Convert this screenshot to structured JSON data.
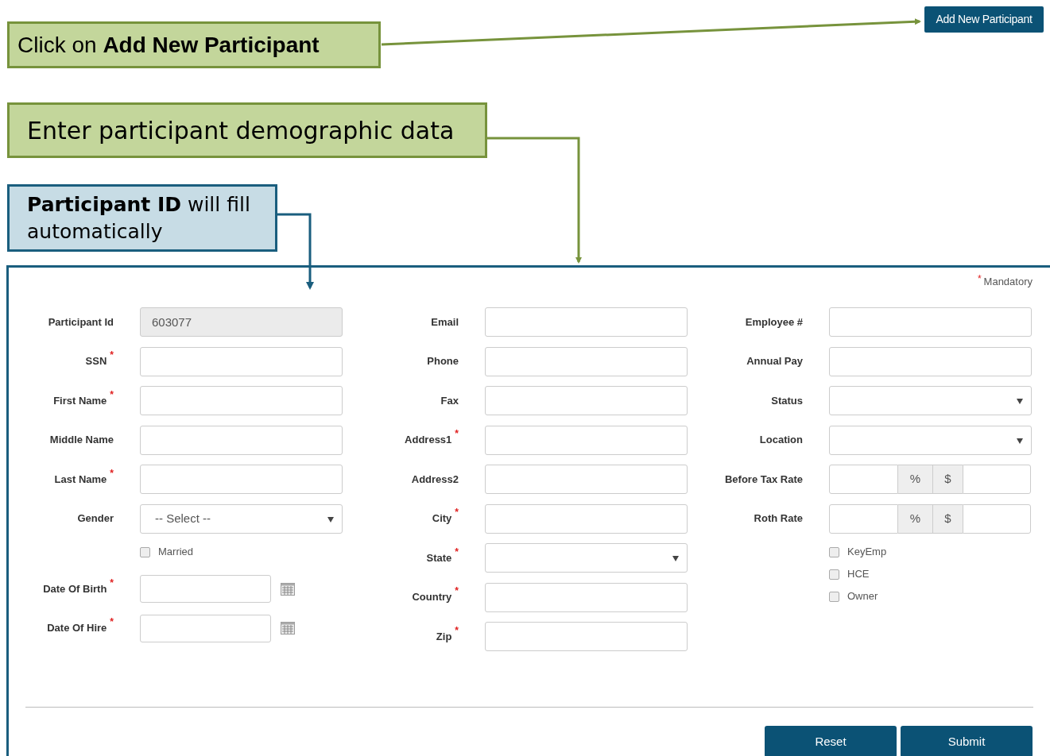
{
  "header_button": "Add New Participant",
  "callouts": [
    {
      "kind": "note",
      "text": "Click on **Add New Participant**"
    },
    {
      "kind": "note",
      "text": "Enter participant demographic data"
    },
    {
      "kind": "info",
      "text": "**Participant ID** will fill automatically"
    }
  ],
  "form": {
    "required_mark": "*",
    "mandatory_note": "Mandatory",
    "columns": [
      [
        {
          "kind": "text",
          "label": "Participant Id",
          "required": false,
          "value": "603077",
          "disabled": true
        },
        {
          "kind": "text",
          "label": "SSN",
          "required": true
        },
        {
          "kind": "text",
          "label": "First Name",
          "required": true
        },
        {
          "kind": "text",
          "label": "Middle Name",
          "required": false
        },
        {
          "kind": "text",
          "label": "Last Name",
          "required": true
        },
        {
          "kind": "select",
          "label": "Gender",
          "required": false,
          "value": "-- Select --"
        },
        {
          "kind": "checkbox",
          "label": "Married",
          "checked": false
        },
        {
          "kind": "date",
          "label": "Date Of Birth",
          "required": true
        },
        {
          "kind": "date",
          "label": "Date Of Hire",
          "required": true
        }
      ],
      [
        {
          "kind": "text",
          "label": "Email",
          "required": false
        },
        {
          "kind": "text",
          "label": "Phone",
          "required": false
        },
        {
          "kind": "text",
          "label": "Fax",
          "required": false
        },
        {
          "kind": "text",
          "label": "Address1",
          "required": true
        },
        {
          "kind": "text",
          "label": "Address2",
          "required": false
        },
        {
          "kind": "text",
          "label": "City",
          "required": true
        },
        {
          "kind": "select",
          "label": "State",
          "required": true
        },
        {
          "kind": "text",
          "label": "Country",
          "required": true
        },
        {
          "kind": "text",
          "label": "Zip",
          "required": true
        }
      ],
      [
        {
          "kind": "text",
          "label": "Employee #",
          "required": false
        },
        {
          "kind": "text",
          "label": "Annual Pay",
          "required": false
        },
        {
          "kind": "select",
          "label": "Status",
          "required": false
        },
        {
          "kind": "select",
          "label": "Location",
          "required": false
        },
        {
          "kind": "rate",
          "label": "Before Tax Rate",
          "required": false,
          "percent": "%",
          "dollar": "$"
        },
        {
          "kind": "rate",
          "label": "Roth Rate",
          "required": false,
          "percent": "%",
          "dollar": "$"
        },
        {
          "kind": "checkbox",
          "label": "KeyEmp",
          "checked": false
        },
        {
          "kind": "checkbox",
          "label": "HCE",
          "checked": false
        },
        {
          "kind": "checkbox",
          "label": "Owner",
          "checked": false
        }
      ]
    ],
    "buttons": [
      "Reset",
      "Submit"
    ]
  }
}
